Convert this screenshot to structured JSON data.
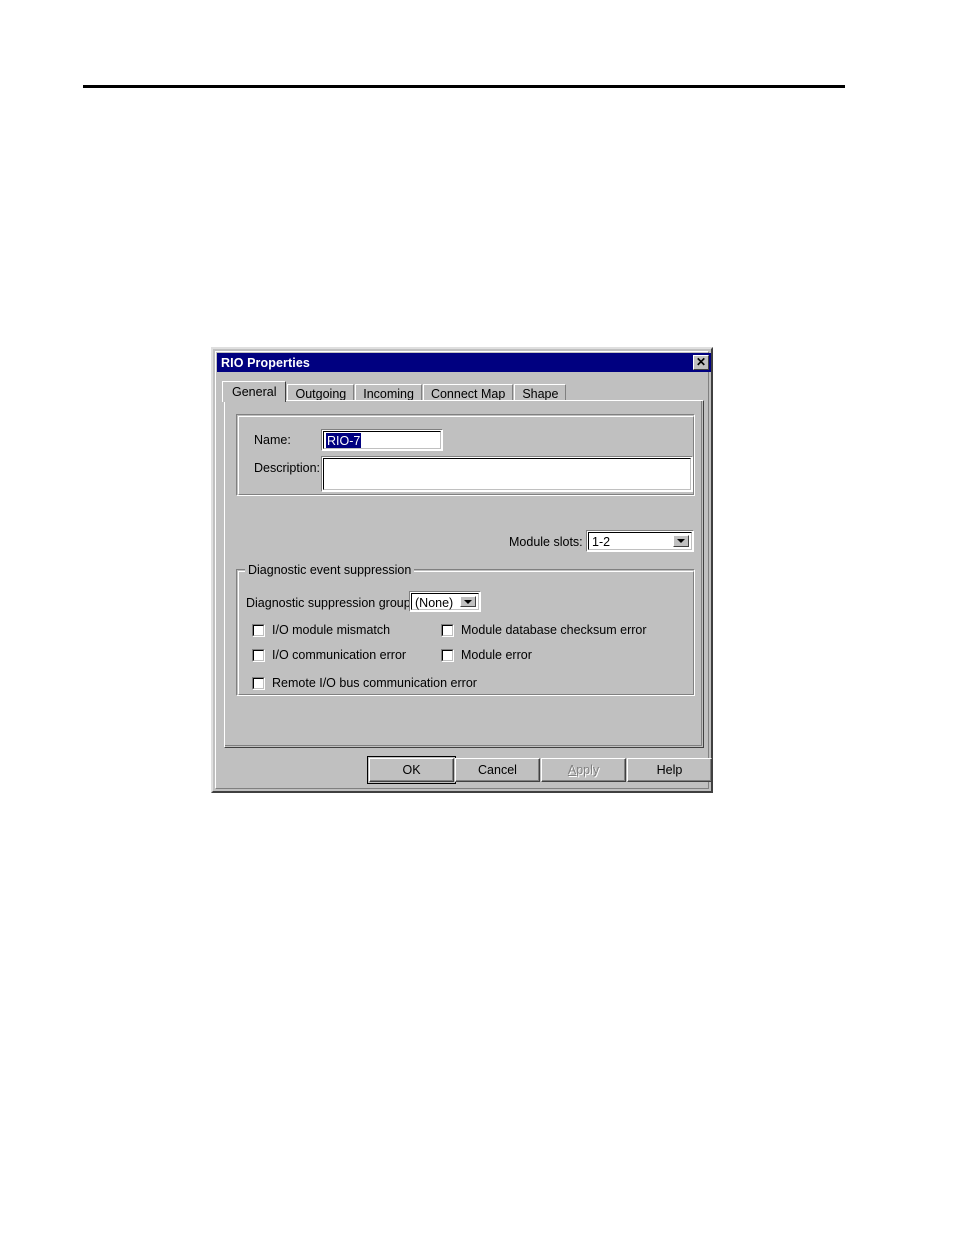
{
  "page": {
    "rule_visible": true
  },
  "dialog": {
    "title": "RIO Properties",
    "close_icon": "close-icon",
    "close_glyph": "✕",
    "colors": {
      "titlebar": "#000080",
      "face": "#c0c0c0",
      "selection": "#000080",
      "selection_text": "#ffffff"
    },
    "tabs": [
      {
        "label": "General",
        "active": true
      },
      {
        "label": "Outgoing",
        "active": false
      },
      {
        "label": "Incoming",
        "active": false
      },
      {
        "label": "Connect Map",
        "active": false
      },
      {
        "label": "Shape",
        "active": false
      }
    ],
    "general": {
      "name_label": "Name:",
      "name_value": "RIO-7",
      "name_selected": true,
      "description_label": "Description:",
      "description_value": "",
      "module_slots_label": "Module slots:",
      "module_slots_value": "1-2",
      "module_slots_arrow_icon": "chevron-down-icon",
      "diagnostic": {
        "group_title": "Diagnostic event suppression",
        "suppression_group_label": "Diagnostic suppression group:",
        "suppression_group_value": "(None)",
        "suppression_group_arrow_icon": "chevron-down-icon",
        "checkboxes": [
          {
            "label": "I/O module mismatch",
            "checked": false
          },
          {
            "label": "Module database checksum error",
            "checked": false
          },
          {
            "label": "I/O communication error",
            "checked": false
          },
          {
            "label": "Module error",
            "checked": false
          },
          {
            "label": "Remote I/O bus communication error",
            "checked": false
          }
        ]
      }
    },
    "buttons": [
      {
        "label": "OK",
        "default": true,
        "disabled": false
      },
      {
        "label": "Cancel",
        "default": false,
        "disabled": false
      },
      {
        "label": "Apply",
        "default": false,
        "disabled": true,
        "accel": "A"
      },
      {
        "label": "Help",
        "default": false,
        "disabled": false
      }
    ]
  }
}
